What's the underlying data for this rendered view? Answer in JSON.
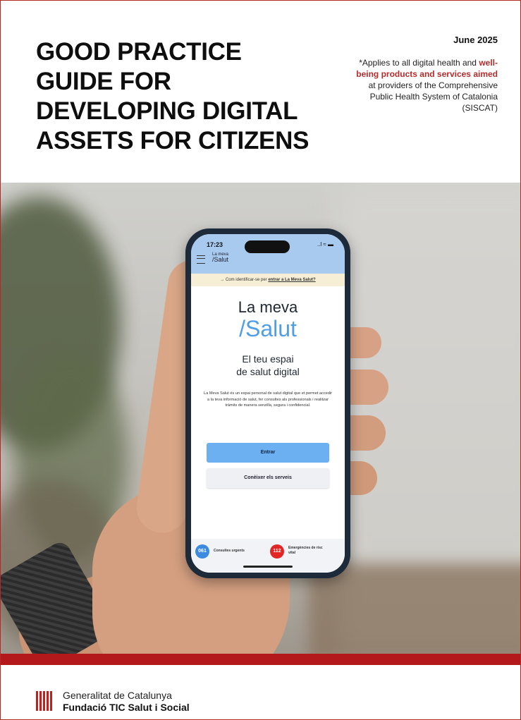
{
  "cover": {
    "title_lines": [
      "GOOD PRACTICE",
      "GUIDE FOR",
      "DEVELOPING DIGITAL",
      "ASSETS FOR CITIZENS"
    ],
    "date": "June 2025",
    "note_prefix": "*Applies to all digital health and ",
    "note_highlight": "well-being products and services aimed",
    "note_suffix": " at providers of the Comprehensive Public Health System of Catalonia (SISCAT)"
  },
  "phone": {
    "time": "17:23",
    "signal": "..l ≈ ▬",
    "app_logo_top": "La meva",
    "app_logo_bottom": "/Salut",
    "banner_text": "→ Com identificar-se per ",
    "banner_link": "entrar a La Meva Salut?",
    "brand_top": "La meva",
    "brand_bottom": "/Salut",
    "tagline_1": "El teu espai",
    "tagline_2": "de salut digital",
    "description": "La Meva Salut és un espai personal de salut digital que et permet accedir a la teva informació de salut, fer consultes als professionals i realitzar tràmits de manera senzilla, segura i confidencial.",
    "primary_button": "Entrar",
    "secondary_button": "Conèixer els serveis",
    "urgent_number": "061",
    "urgent_label": "Consultes urgents",
    "emergency_number": "112",
    "emergency_label": "Emergències de risc vital"
  },
  "footer": {
    "org_line1": "Generalitat de Catalunya",
    "org_line2": "Fundació TIC Salut i Social"
  },
  "colors": {
    "accent_red": "#b3191b",
    "highlight_red": "#b62b2b",
    "app_blue": "#4f9ee6"
  }
}
